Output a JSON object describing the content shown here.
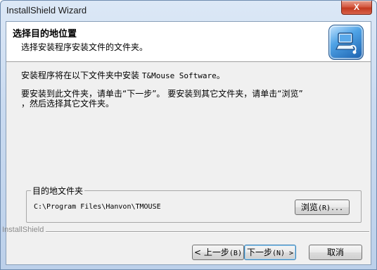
{
  "window": {
    "title": "InstallShield Wizard",
    "close_label": "X"
  },
  "header": {
    "title": "选择目的地位置",
    "subtitle": "选择安装程序安装文件的文件夹。",
    "logo_icon": "installshield-computer-icon"
  },
  "body": {
    "line1_prefix": "安装程序将在以下文件夹中安装 ",
    "line1_product": "T&Mouse Software",
    "line1_suffix": "。",
    "line2": "要安装到此文件夹，请单击“下一步”。 要安装到其它文件夹，请单击“浏览”",
    "line3": "，然后选择其它文件夹。"
  },
  "destination": {
    "group_label": "目的地文件夹",
    "path": "C:\\Program Files\\Hanvon\\TMOUSE",
    "browse_label": "浏览",
    "browse_shortcut": "(R)..."
  },
  "footer": {
    "brand": "InstallShield",
    "back_label": "< 上一步",
    "back_shortcut": "(B)",
    "next_label": "下一步",
    "next_shortcut": "(N) >",
    "cancel_label": "取消"
  },
  "colors": {
    "titlebar": "#c9daf0",
    "close_button": "#c2391f",
    "dialog_bg": "#f0f0f0",
    "header_bg": "#ffffff"
  }
}
